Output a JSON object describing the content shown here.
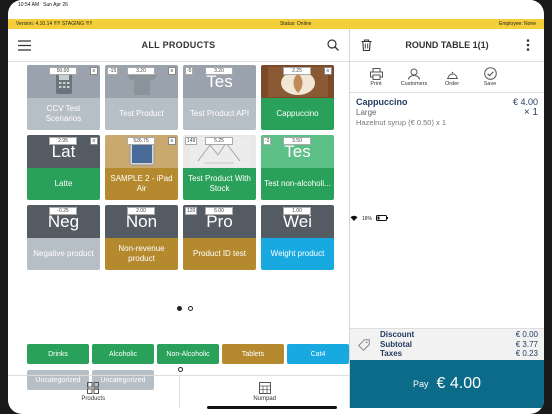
{
  "status_bar": {
    "time": "10:54 AM",
    "date": "Sun Apr 26",
    "battery": "16%"
  },
  "info_bar": {
    "version": "Version: 4.10.14 !!!!! STAGING !!!!!",
    "status": "Status: Online",
    "employee": "Employee: None"
  },
  "products_panel": {
    "title": "ALL PRODUCTS"
  },
  "products": [
    {
      "name": "CCV Test Scenarios",
      "price": "50.00",
      "stock": "",
      "top_text": "",
      "top_color": "#9aa3ad",
      "bottom_color": "#b6bec6",
      "image": "card-terminal",
      "menu_flag": true
    },
    {
      "name": "Test Product",
      "price": "3.20",
      "stock": "-15",
      "top_text": "",
      "top_color": "#9aa3ad",
      "bottom_color": "#b6bec6",
      "image": "tshirt",
      "menu_flag": true
    },
    {
      "name": "Test Product API",
      "price": "3.20",
      "stock": "-5",
      "top_text": "Tes",
      "top_color": "#9aa3ad",
      "bottom_color": "#b6bec6",
      "image": "",
      "menu_flag": false
    },
    {
      "name": "Cappuccino",
      "price": "2.25",
      "stock": "",
      "top_text": "",
      "top_color": "#7a4a2a",
      "bottom_color": "#2aa15a",
      "image": "coffee",
      "menu_flag": true
    },
    {
      "name": "Latte",
      "price": "2.95",
      "stock": "",
      "top_text": "Lat",
      "top_color": "#555b62",
      "bottom_color": "#2aa15a",
      "image": "",
      "menu_flag": true
    },
    {
      "name": "SAMPLE 2 - iPad Air",
      "price": "526.75",
      "stock": "",
      "top_text": "",
      "top_color": "#c9a96e",
      "bottom_color": "#b58a2e",
      "image": "ipad",
      "menu_flag": true
    },
    {
      "name": "Test Product With Stock",
      "price": "5.25",
      "stock": "149",
      "top_text": "",
      "top_color": "#e8e8e8",
      "bottom_color": "#2aa15a",
      "image": "sketch",
      "menu_flag": false
    },
    {
      "name": "Test non-alcoholi...",
      "price": "3.50",
      "stock": "-2",
      "top_text": "Tes",
      "top_color": "#5cbf86",
      "bottom_color": "#2aa15a",
      "image": "",
      "menu_flag": false
    },
    {
      "name": "Negative product",
      "price": "-0.25",
      "stock": "",
      "top_text": "Neg",
      "top_color": "#555b62",
      "bottom_color": "#b6bec6",
      "image": "",
      "menu_flag": false
    },
    {
      "name": "Non-revenue product",
      "price": "2.00",
      "stock": "",
      "top_text": "Non",
      "top_color": "#555b62",
      "bottom_color": "#b58a2e",
      "image": "",
      "menu_flag": false
    },
    {
      "name": "Product ID test",
      "price": "6.00",
      "stock": "120",
      "top_text": "Pro",
      "top_color": "#555b62",
      "bottom_color": "#b58a2e",
      "image": "",
      "menu_flag": false
    },
    {
      "name": "Weight product",
      "price": "1.00",
      "stock": "",
      "top_text": "Wei",
      "top_color": "#555b62",
      "bottom_color": "#18a9e0",
      "image": "",
      "menu_flag": false
    }
  ],
  "categories": [
    {
      "label": "Drinks",
      "color": "#2aa15a"
    },
    {
      "label": "Alcoholic",
      "color": "#2aa15a"
    },
    {
      "label": "Non-Alcoholic",
      "color": "#2aa15a"
    },
    {
      "label": "Tablets",
      "color": "#b58a2e"
    },
    {
      "label": "Cat4",
      "color": "#18a9e0"
    },
    {
      "label": "Uncategorized",
      "color": "#b6bec6"
    },
    {
      "label": "Uncategorized",
      "color": "#b6bec6"
    }
  ],
  "bottom_nav": {
    "products": "Products",
    "numpad": "Numpad"
  },
  "order_panel": {
    "title": "ROUND TABLE 1(1)"
  },
  "order_actions": {
    "print": "Print",
    "customers": "Customers",
    "order": "Order",
    "save": "Save"
  },
  "order_line": {
    "name": "Cappuccino",
    "price": "€ 4.00",
    "variant": "Large",
    "quantity": "× 1",
    "modifier": "Hazelnut syrup (€ 0.50) x 1"
  },
  "totals": {
    "discount_label": "Discount",
    "discount_value": "€ 0.00",
    "subtotal_label": "Subtotal",
    "subtotal_value": "€ 3.77",
    "taxes_label": "Taxes",
    "taxes_value": "€ 0.23"
  },
  "pay": {
    "label": "Pay",
    "amount": "€ 4.00"
  }
}
